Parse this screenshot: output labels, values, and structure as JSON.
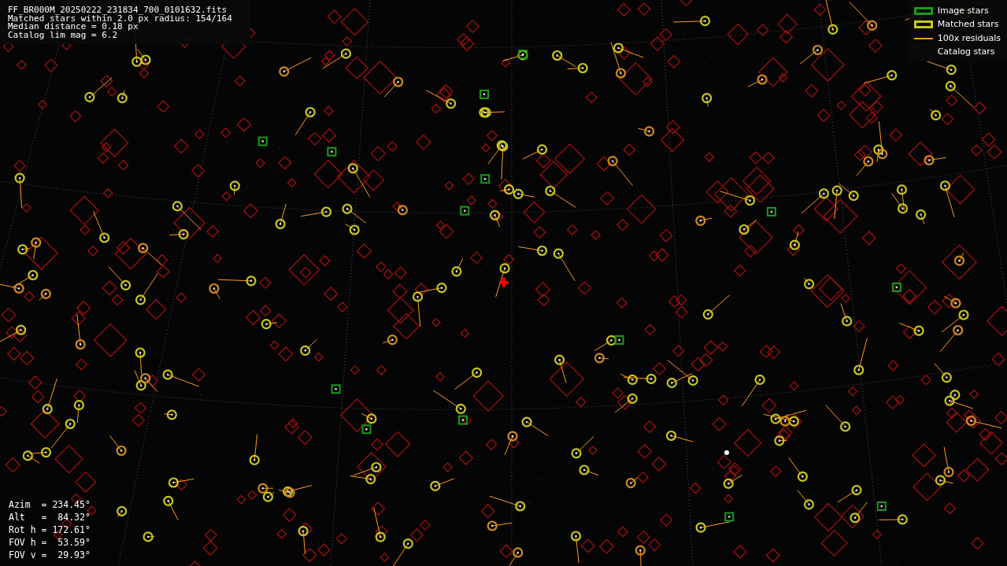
{
  "info": {
    "lines": [
      "FF_BR000M_20250222_231834_700_0101632.fits",
      "Matched stars within 2.0 px radius: 154/164",
      "Median distance = 0.18 px",
      "Catalog lim mag = 6.2"
    ]
  },
  "legend": [
    {
      "kind": "box",
      "label": "Image stars",
      "color": "#1a9a1a"
    },
    {
      "kind": "box",
      "label": "Matched stars",
      "color": "#c8c81e"
    },
    {
      "kind": "line",
      "label": "100x residuals",
      "color": "#ff9a1e"
    },
    {
      "kind": "none",
      "label": "Catalog stars"
    }
  ],
  "pointing": [
    "Azim  = 234.45°",
    "Alt   =  84.32°",
    "Rot h = 172.61°",
    "FOV h =  53.59°",
    "FOV v =  29.93°"
  ]
}
